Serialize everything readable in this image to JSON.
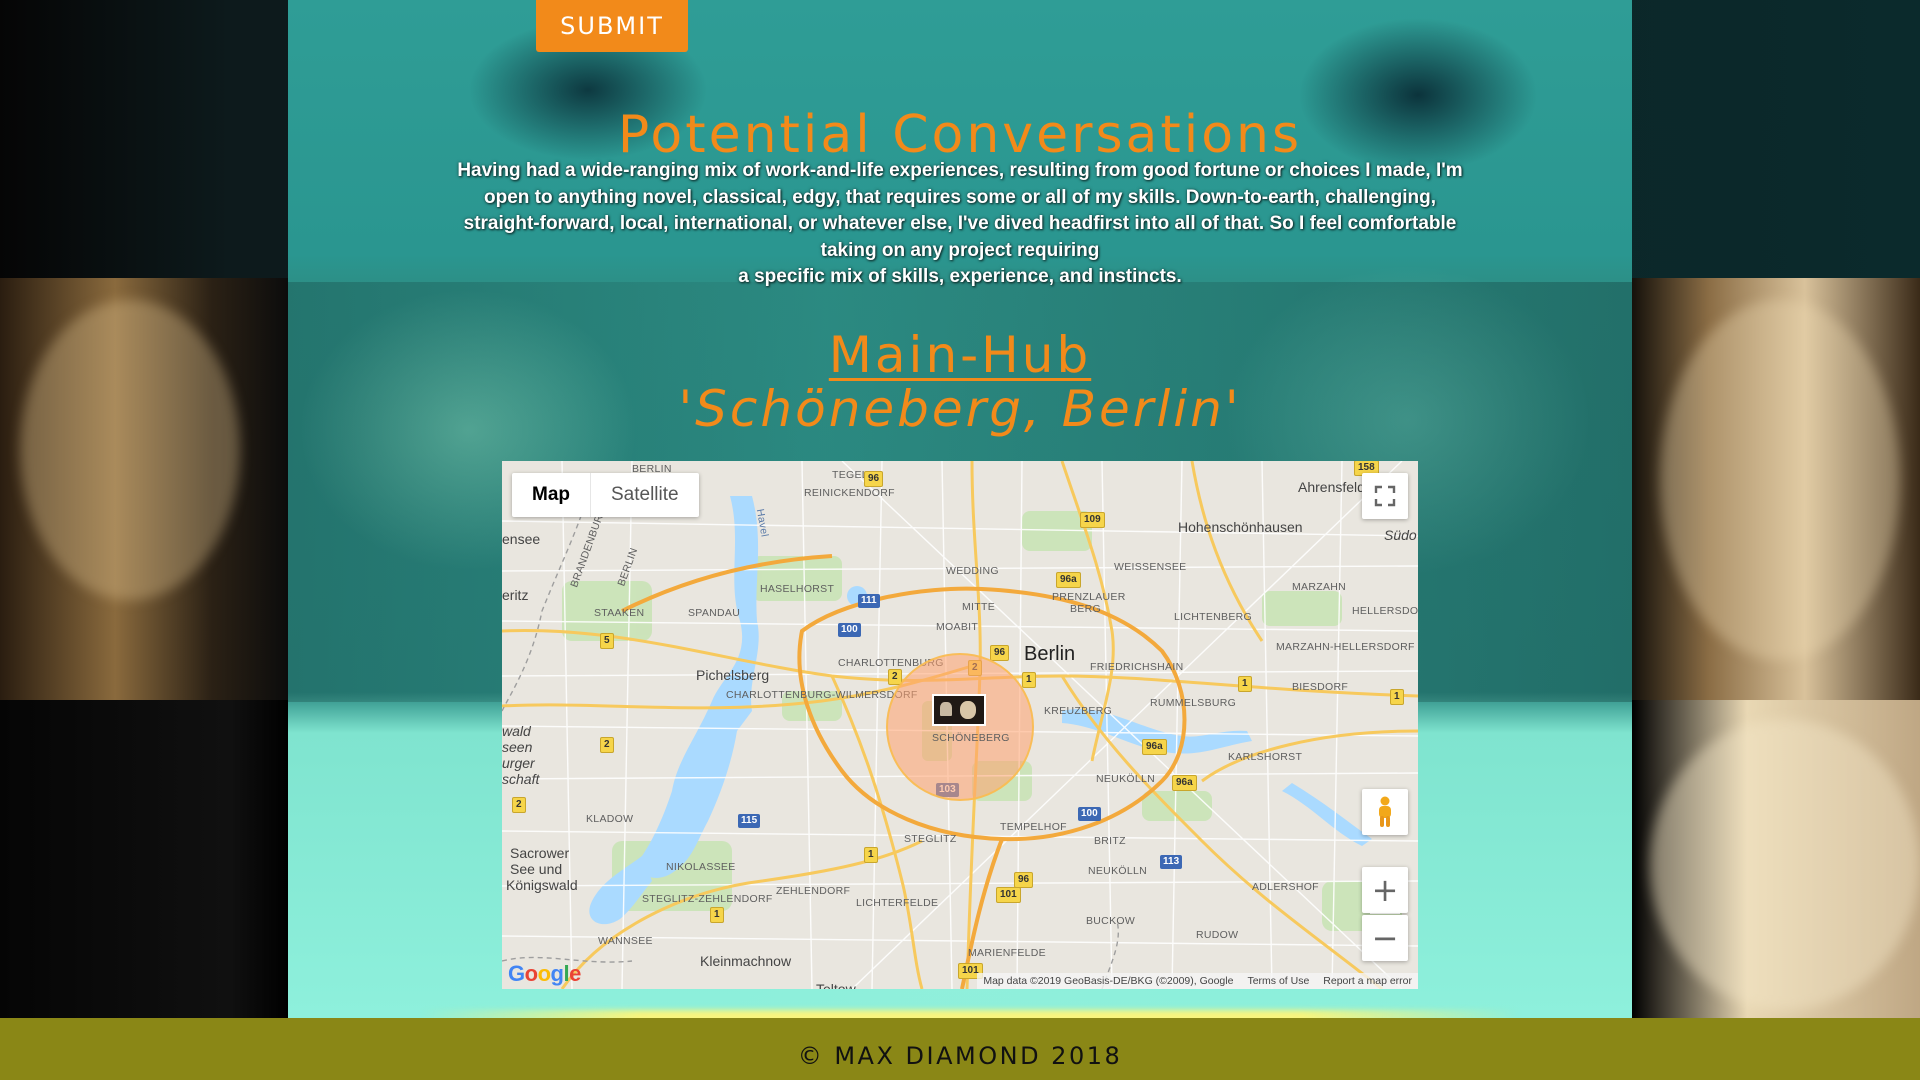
{
  "form": {
    "submit_label": "SUBMIT"
  },
  "conversations": {
    "title": "Potential Conversations",
    "text_lines": [
      "Having had a wide-ranging mix of work-and-life experiences, resulting from good fortune or choices I made, I'm",
      "open to anything novel, classical, edgy, that requires some or all of my skills. Down-to-earth, challenging,",
      "straight-forward, local, international, or whatever else, I've dived headfirst into all of that. So I feel comfortable",
      "taking on any project requiring",
      "a specific mix of skills, experience, and instincts."
    ]
  },
  "hub": {
    "title": "Main-Hub",
    "subtitle": "'Schöneberg, Berlin'"
  },
  "map": {
    "type_options": [
      "Map",
      "Satellite"
    ],
    "active_type": "Map",
    "zoom_in": "+",
    "zoom_out": "−",
    "city_label": "Berlin",
    "marker_label": "SCHÖNEBERG",
    "places": {
      "tegel": "TEGEL",
      "reinickendorf": "REINICKENDORF",
      "wedding": "WEDDING",
      "weissensee": "WEISSENSEE",
      "hohenschoenhausen": "Hohenschönhausen",
      "ahrensfelde": "Ahrensfelde",
      "suedost": "Südo",
      "haselhorst": "HASELHORST",
      "mitte": "MITTE",
      "prenzlauer": "PRENZLAUER",
      "berg": "BERG",
      "marzahn": "MARZAHN",
      "hellersdorf": "HELLERSDORF",
      "staaken": "STAAKEN",
      "spandau": "SPANDAU",
      "moabit": "MOABIT",
      "lichtenberg": "LICHTENBERG",
      "marzahn_hellersdorf": "MARZAHN-HELLERSDORF",
      "charlottenburg": "CHARLOTTENBURG",
      "friedrichshain": "FRIEDRICHSHAIN",
      "pichelsberg": "Pichelsberg",
      "charlottenburg_wilmersdorf": "CHARLOTTENBURG-WILMERSDORF",
      "biesdorf": "BIESDORF",
      "kreuzberg": "KREUZBERG",
      "rummelsburg": "RUMMELSBURG",
      "karlshorst": "KARLSHORST",
      "neukoelln_upper": "NEUKÖLLN",
      "kladow": "KLADOW",
      "tempelhof": "TEMPELHOF",
      "steglitz": "STEGLITZ",
      "britz": "BRITZ",
      "sacrower": "Sacrower",
      "see_und": "See und",
      "koenigswald": "Königswald",
      "nikolassee": "NIKOLASSEE",
      "zehlendorf": "ZEHLENDORF",
      "neukoelln_lower": "NEUKÖLLN",
      "adlershof": "ADLERSHOF",
      "steglitz_zehlendorf": "STEGLITZ-ZEHLENDORF",
      "lichterfelde": "LICHTERFELDE",
      "buckow": "BUCKOW",
      "wannsee": "WANNSEE",
      "rudow": "RUDOW",
      "kleinmachnow": "Kleinmachnow",
      "marienfelde": "MARIENFELDE",
      "teltow": "Teltow",
      "ensee": "ensee",
      "eritz": "eritz",
      "wald": "wald",
      "seen": "seen",
      "urger": "urger",
      "schaft": "schaft",
      "havel": "Havel",
      "brandenburg": "BRANDENBURG",
      "berlin_border": "BERLIN",
      "berlin_border_top": "BERLIN"
    },
    "road_badges": {
      "b96_top": "96",
      "b158": "158",
      "b109": "109",
      "b96a_1": "96a",
      "b111": "111",
      "b100_1": "100",
      "b5": "5",
      "b96_mid": "96",
      "b2_1": "2",
      "b2_2": "2",
      "b1_1": "1",
      "b1_2": "1",
      "b1_3": "1",
      "b96a_2": "96a",
      "b96a_3": "96a",
      "b2_3": "2",
      "b115": "115",
      "b103": "103",
      "b100_2": "100",
      "b2_4": "2",
      "b1_4": "1",
      "b96_low": "96",
      "b101_1": "101",
      "b113": "113",
      "b1_5": "1",
      "b101_2": "101"
    },
    "google_logo": "Google",
    "attribution": {
      "map_data": "Map data ©2019 GeoBasis-DE/BKG (©2009), Google",
      "terms": "Terms of Use",
      "report": "Report a map error"
    }
  },
  "footer": {
    "text": "© Max Diamond 2018"
  },
  "colors": {
    "accent": "#f28a1a",
    "footer_bg": "#8a8716",
    "panel_teal": "#2f9d96"
  }
}
